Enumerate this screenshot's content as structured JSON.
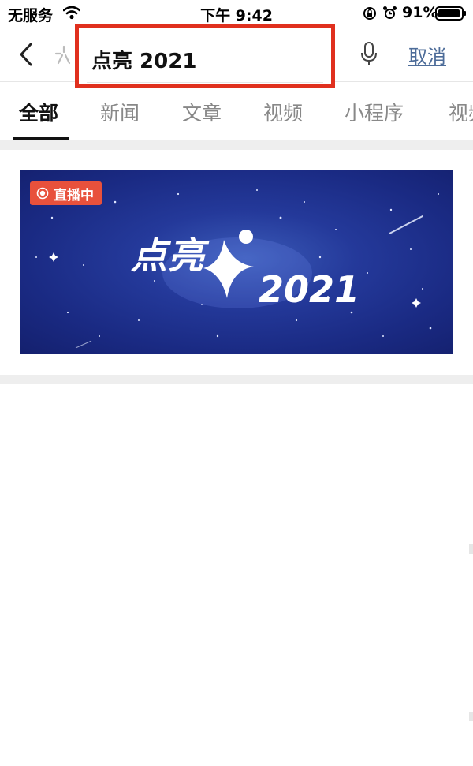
{
  "status_bar": {
    "carrier": "无服务",
    "time": "下午 9:42",
    "battery_percent": "91%"
  },
  "search": {
    "query": "点亮 2021",
    "cancel_label": "取消"
  },
  "tabs": [
    {
      "label": "全部",
      "active": true
    },
    {
      "label": "新闻",
      "active": false
    },
    {
      "label": "文章",
      "active": false
    },
    {
      "label": "视频",
      "active": false
    },
    {
      "label": "小程序",
      "active": false
    },
    {
      "label": "视频",
      "active": false
    }
  ],
  "live_card": {
    "badge": "直播中",
    "banner_title": "点亮",
    "banner_year": "2021"
  },
  "colors": {
    "highlight_border": "#e0301e",
    "live_badge": "#e8513c",
    "cancel_link": "#4d6c99",
    "banner_background": "#1a2a83"
  },
  "icons": [
    "wifi-icon",
    "rotation-lock-icon",
    "alarm-icon",
    "battery-icon",
    "back-icon",
    "ghost-icon",
    "mic-icon",
    "live-dot-icon",
    "star-logo-icon"
  ]
}
